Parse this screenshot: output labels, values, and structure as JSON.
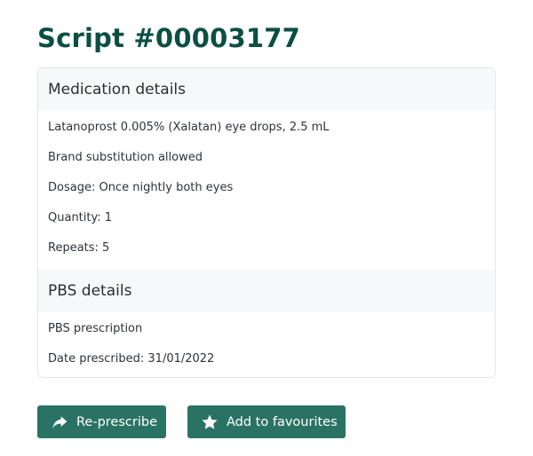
{
  "page": {
    "title": "Script #00003177"
  },
  "medication": {
    "header": "Medication details",
    "drug": "Latanoprost 0.005% (Xalatan) eye drops, 2.5 mL",
    "substitution": "Brand substitution allowed",
    "dosage": "Dosage: Once nightly both eyes",
    "quantity": "Quantity: 1",
    "repeats": "Repeats: 5"
  },
  "pbs": {
    "header": "PBS details",
    "type": "PBS prescription",
    "date_prescribed": "Date prescribed: 31/01/2022"
  },
  "actions": {
    "represcribe_label": "Re-prescribe",
    "represcribe_icon": "share-arrow-icon",
    "favourite_label": "Add to favourites",
    "favourite_icon": "star-icon"
  },
  "colors": {
    "title": "#0b4f43",
    "button_bg": "#2a7364",
    "section_header_bg": "#f7f8f9"
  }
}
